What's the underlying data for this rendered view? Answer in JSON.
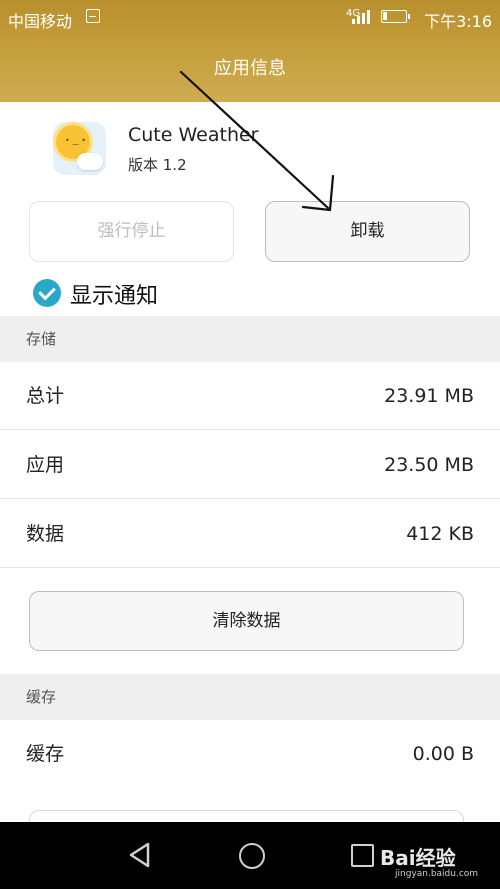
{
  "status_bar": {
    "carrier": "中国移动",
    "signal_type": "4G",
    "time": "下午3:16",
    "battery_level": 0.2
  },
  "title_bar": {
    "title": "应用信息"
  },
  "app": {
    "name": "Cute Weather",
    "version": "版本 1.2"
  },
  "buttons": {
    "force_stop": "强行停止",
    "uninstall": "卸载",
    "clear_data": "清除数据"
  },
  "notification": {
    "label": "显示通知",
    "checked": true
  },
  "storage": {
    "header": "存储",
    "rows": [
      {
        "label": "总计",
        "value": "23.91 MB"
      },
      {
        "label": "应用",
        "value": "23.50 MB"
      },
      {
        "label": "数据",
        "value": "412 KB"
      }
    ]
  },
  "cache": {
    "header": "缓存",
    "rows": [
      {
        "label": "缓存",
        "value": "0.00 B"
      }
    ]
  },
  "watermark": {
    "brand": "Bai经验",
    "url": "jingyan.baidu.com"
  },
  "colors": {
    "header_gold": "#c19a36",
    "check_blue": "#2aa8c8",
    "section_gray": "#efefef"
  }
}
